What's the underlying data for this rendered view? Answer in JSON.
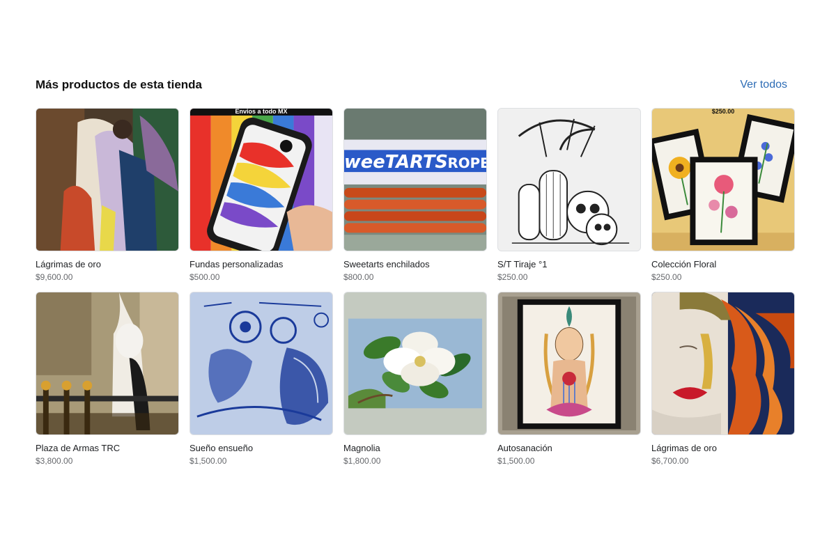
{
  "section": {
    "title": "Más productos de esta tienda",
    "see_all": "Ver todos"
  },
  "products": [
    {
      "title": "Lágrimas de oro",
      "price": "$9,600.00",
      "image": "abstract-embracing-couple-painting"
    },
    {
      "title": "Fundas personalizadas",
      "price": "$500.00",
      "image": "rainbow-phone-case",
      "overlay": "Envios a todo MX"
    },
    {
      "title": "Sweetarts enchilados",
      "price": "$800.00",
      "image": "sweetarts-ropes-candy"
    },
    {
      "title": "S/T Tiraje °1",
      "price": "$250.00",
      "image": "ink-skulls-cactus-drawing"
    },
    {
      "title": "Colección Floral",
      "price": "$250.00",
      "image": "framed-floral-drawings",
      "overlay": "$250.00"
    },
    {
      "title": "Plaza de Armas TRC",
      "price": "$3,800.00",
      "image": "plaza-crow-painting"
    },
    {
      "title": "Sueño ensueño",
      "price": "$1,500.00",
      "image": "blue-ink-dream-drawing"
    },
    {
      "title": "Magnolia",
      "price": "$1,800.00",
      "image": "magnolia-flower-painting"
    },
    {
      "title": "Autosanación",
      "price": "$1,500.00",
      "image": "framed-woman-illustration"
    },
    {
      "title": "Lágrimas de oro",
      "price": "$6,700.00",
      "image": "red-hair-woman-gold-leaf-painting"
    }
  ]
}
